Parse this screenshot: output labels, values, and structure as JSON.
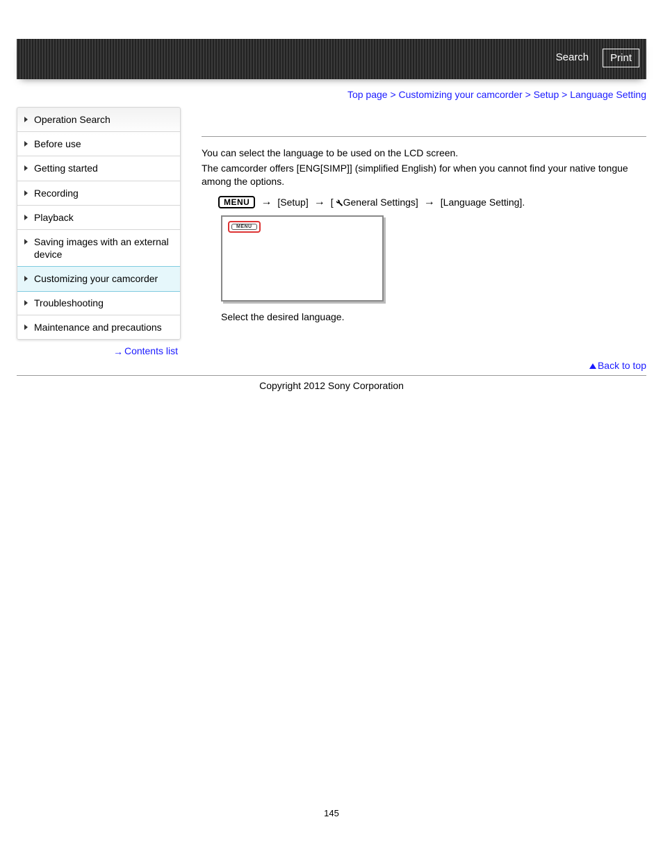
{
  "header": {
    "search_label": "Search",
    "print_label": "Print"
  },
  "breadcrumb": {
    "items": [
      "Top page",
      "Customizing your camcorder",
      "Setup"
    ],
    "current": "Language Setting",
    "sep": ">"
  },
  "sidebar": {
    "items": [
      {
        "label": "Operation Search",
        "active": false
      },
      {
        "label": "Before use",
        "active": false
      },
      {
        "label": "Getting started",
        "active": false
      },
      {
        "label": "Recording",
        "active": false
      },
      {
        "label": "Playback",
        "active": false
      },
      {
        "label": "Saving images with an external device",
        "active": false
      },
      {
        "label": "Customizing your camcorder",
        "active": true
      },
      {
        "label": "Troubleshooting",
        "active": false
      },
      {
        "label": "Maintenance and precautions",
        "active": false
      }
    ],
    "contents_link": "Contents list"
  },
  "content": {
    "p1": "You can select the language to be used on the LCD screen.",
    "p2": "The camcorder offers [ENG[SIMP]] (simplified English) for when you cannot find your native tongue among the options.",
    "menu_badge": "MENU",
    "path_step1": "[Setup]",
    "path_step2_prefix": "[",
    "path_step2_label": "General Settings]",
    "path_step3": "[Language Setting].",
    "mock_menu_label": "MENU",
    "instruction": "Select the desired language."
  },
  "footer": {
    "back_to_top": "Back to top",
    "copyright": "Copyright 2012 Sony Corporation",
    "page_number": "145"
  }
}
